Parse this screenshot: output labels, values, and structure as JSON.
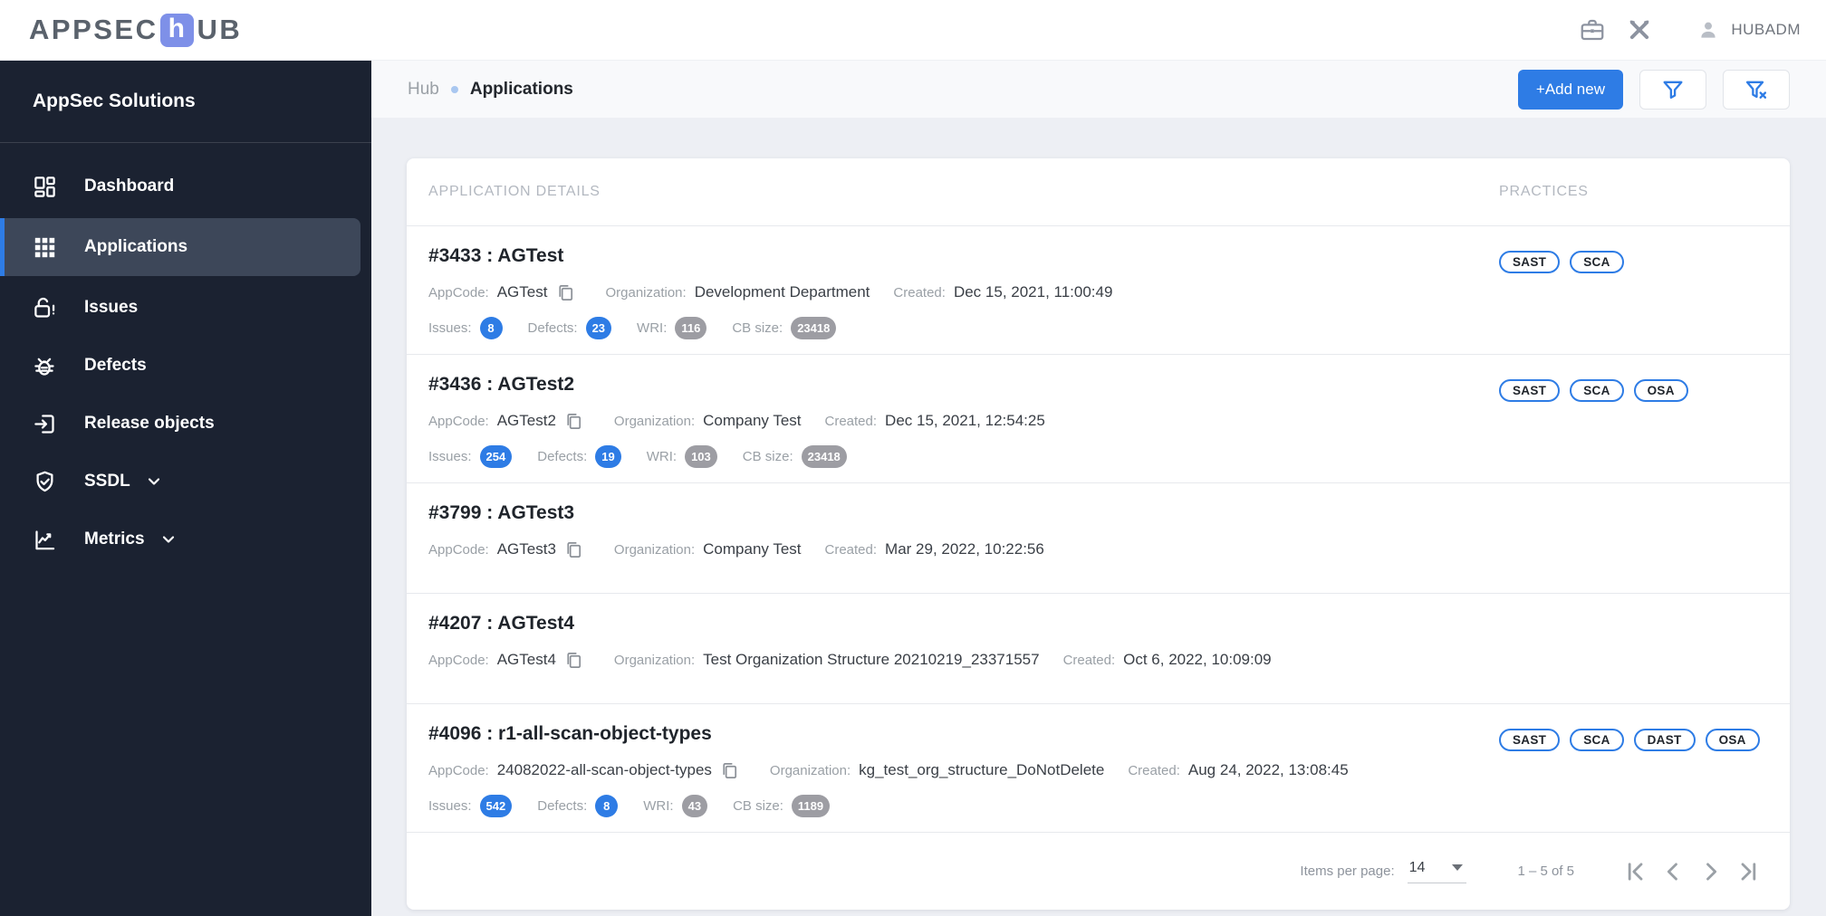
{
  "topbar": {
    "logo": {
      "part1": "APPSEC",
      "accent_letter": "h",
      "part2": "UB"
    },
    "icons": [
      "briefcase-icon",
      "tools-icon"
    ],
    "user": {
      "name": "HUBADM",
      "icon": "user-icon"
    }
  },
  "sidebar": {
    "title": "AppSec Solutions",
    "items": [
      {
        "label": "Dashboard",
        "icon": "dashboard-icon",
        "active": false,
        "expandable": false
      },
      {
        "label": "Applications",
        "icon": "apps-grid-icon",
        "active": true,
        "expandable": false
      },
      {
        "label": "Issues",
        "icon": "lock-alert-icon",
        "active": false,
        "expandable": false
      },
      {
        "label": "Defects",
        "icon": "bug-icon",
        "active": false,
        "expandable": false
      },
      {
        "label": "Release objects",
        "icon": "exit-to-app-icon",
        "active": false,
        "expandable": false
      },
      {
        "label": "SSDL",
        "icon": "shield-check-icon",
        "active": false,
        "expandable": true
      },
      {
        "label": "Metrics",
        "icon": "line-chart-icon",
        "active": false,
        "expandable": true
      }
    ]
  },
  "breadcrumb": {
    "root": "Hub",
    "current": "Applications"
  },
  "actions": {
    "add_new": "+Add new",
    "filter_icon": "filter-icon",
    "filter_clear_icon": "filter-clear-icon"
  },
  "table": {
    "col_details": "APPLICATION DETAILS",
    "col_practices": "PRACTICES",
    "labels": {
      "appcode": "AppCode:",
      "organization": "Organization:",
      "created": "Created:",
      "issues": "Issues:",
      "defects": "Defects:",
      "wri": "WRI:",
      "cb_size": "CB size:"
    },
    "rows": [
      {
        "title": "#3433 : AGTest",
        "appcode": "AGTest",
        "organization": "Development Department",
        "created": "Dec 15, 2021, 11:00:49",
        "stats": {
          "issues": "8",
          "defects": "23",
          "wri": "116",
          "cb_size": "23418"
        },
        "practices": [
          "SAST",
          "SCA"
        ]
      },
      {
        "title": "#3436 : AGTest2",
        "appcode": "AGTest2",
        "organization": "Company Test",
        "created": "Dec 15, 2021, 12:54:25",
        "stats": {
          "issues": "254",
          "defects": "19",
          "wri": "103",
          "cb_size": "23418"
        },
        "practices": [
          "SAST",
          "SCA",
          "OSA"
        ]
      },
      {
        "title": "#3799 : AGTest3",
        "appcode": "AGTest3",
        "organization": "Company Test",
        "created": "Mar 29, 2022, 10:22:56",
        "stats": null,
        "practices": []
      },
      {
        "title": "#4207 : AGTest4",
        "appcode": "AGTest4",
        "organization": "Test Organization Structure 20210219_23371557",
        "created": "Oct 6, 2022, 10:09:09",
        "stats": null,
        "practices": []
      },
      {
        "title": "#4096 : r1-all-scan-object-types",
        "appcode": "24082022-all-scan-object-types",
        "organization": "kg_test_org_structure_DoNotDelete",
        "created": "Aug 24, 2022, 13:08:45",
        "stats": {
          "issues": "542",
          "defects": "8",
          "wri": "43",
          "cb_size": "1189"
        },
        "practices": [
          "SAST",
          "SCA",
          "DAST",
          "OSA"
        ]
      }
    ]
  },
  "pagination": {
    "items_per_page_label": "Items per page:",
    "items_per_page": "14",
    "range": "1 – 5 of 5",
    "nav_icons": [
      "first-page-icon",
      "prev-page-icon",
      "next-page-icon",
      "last-page-icon"
    ]
  },
  "colors": {
    "accent_blue": "#2e7ce5",
    "sidebar_bg": "#1b2231",
    "badge_gray": "#9d9da3"
  }
}
